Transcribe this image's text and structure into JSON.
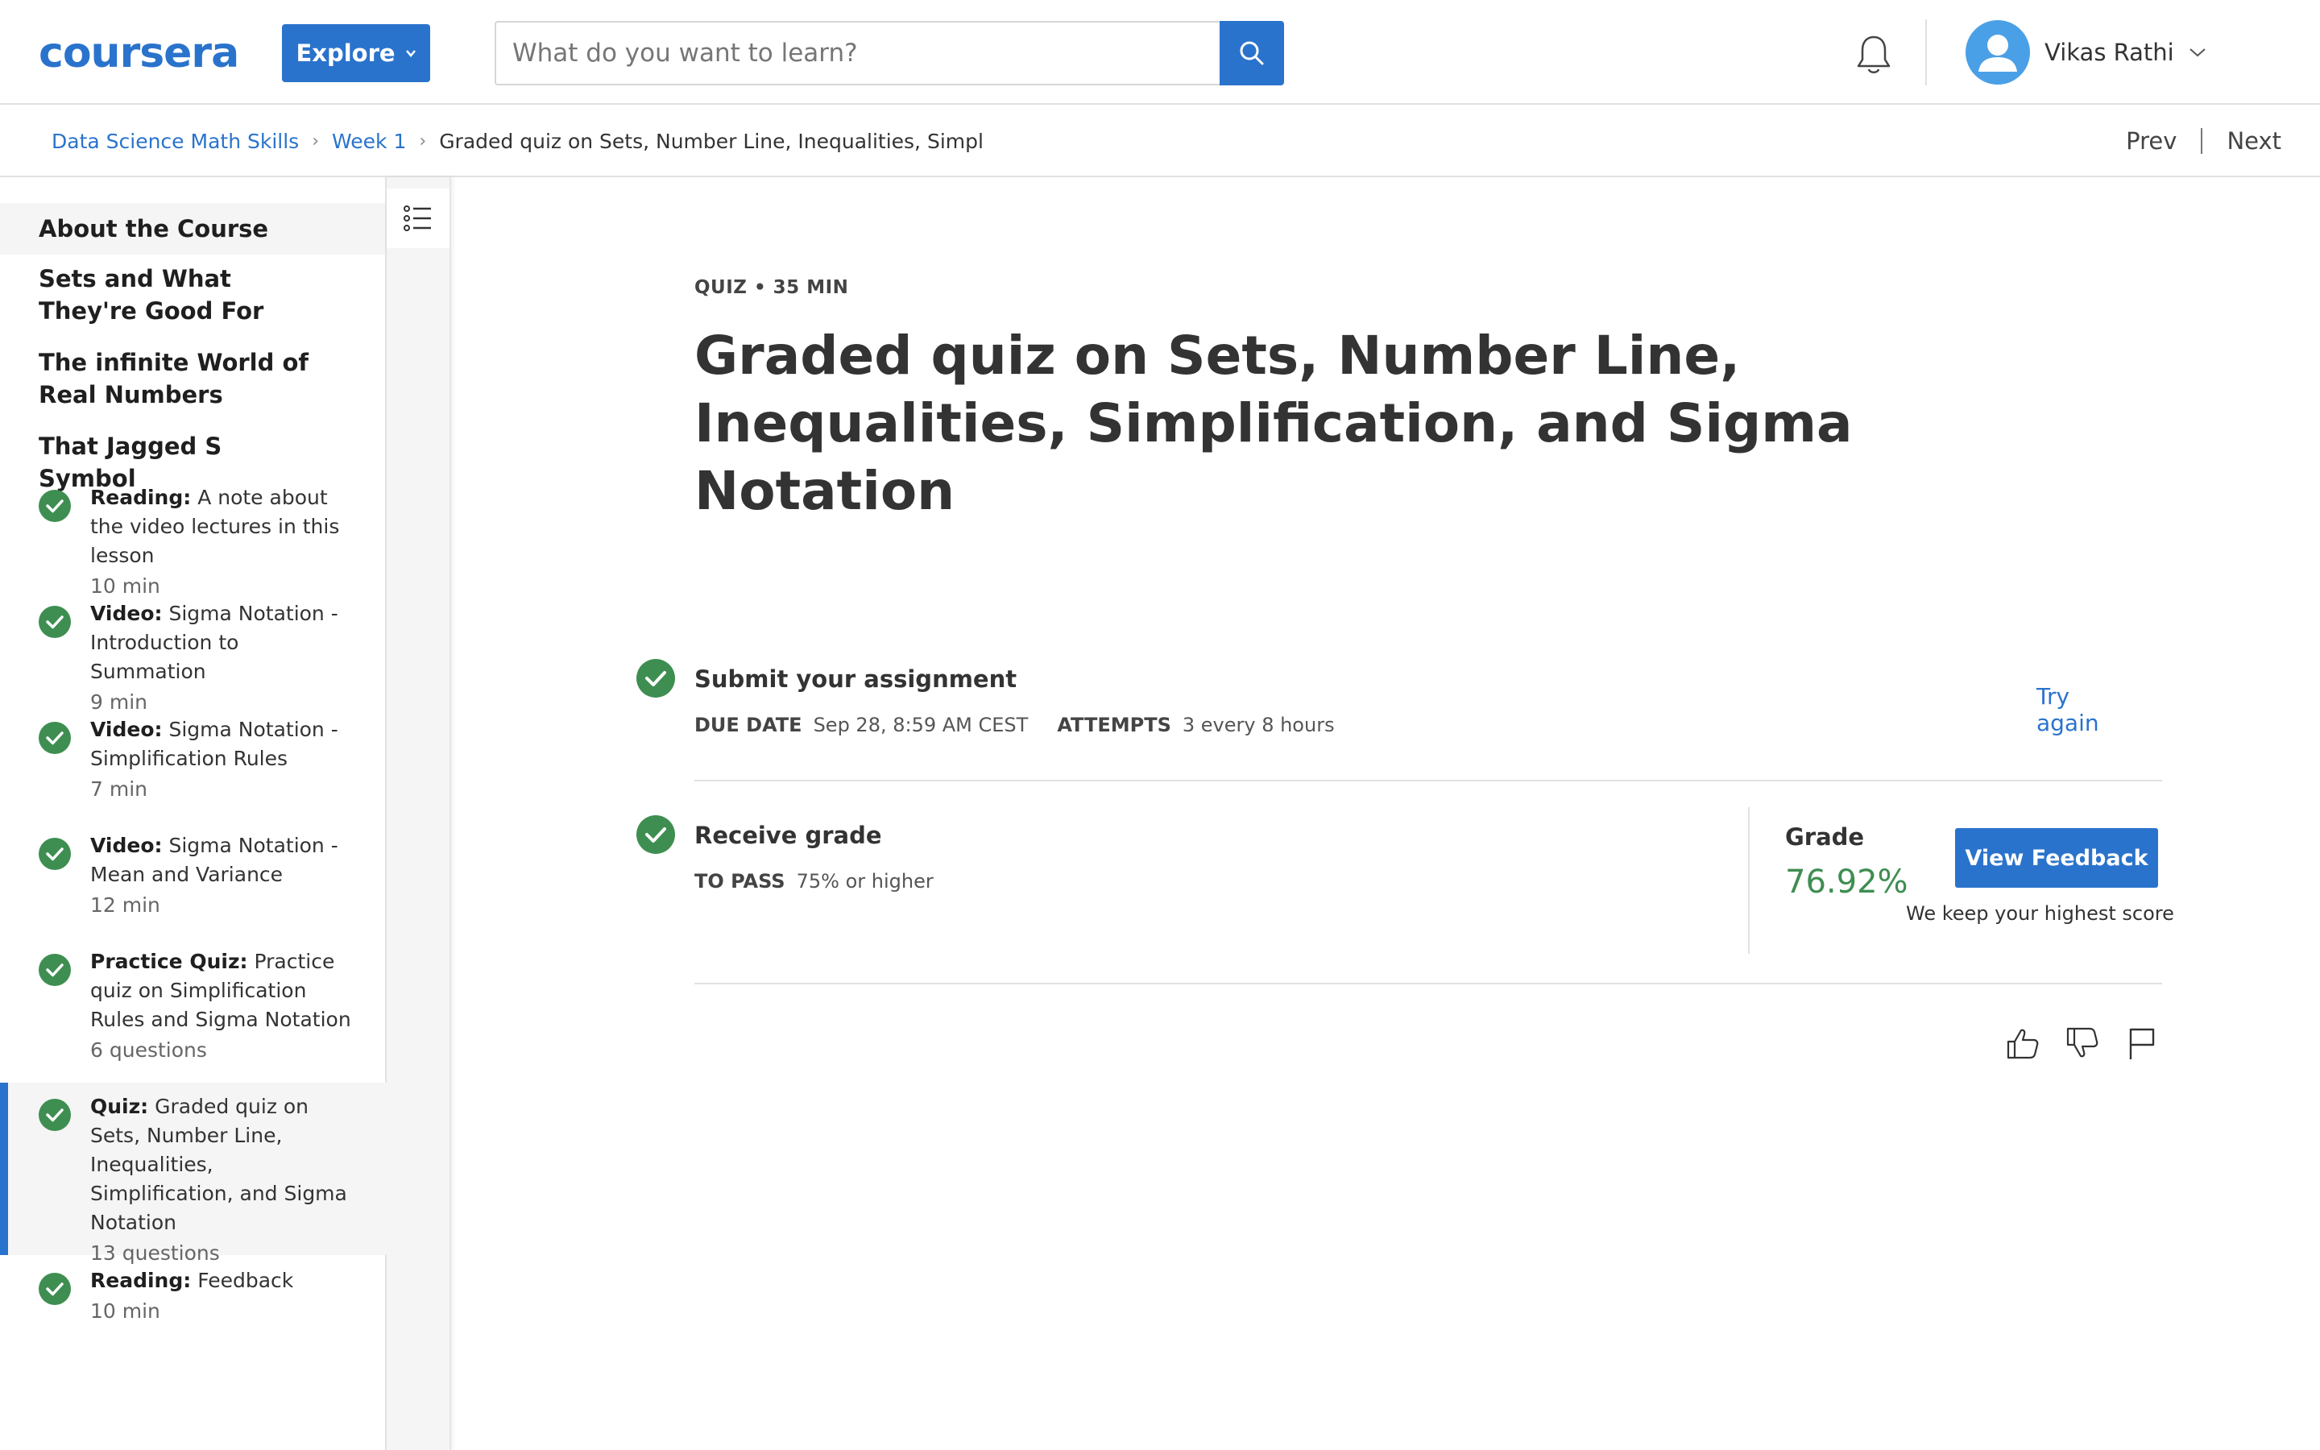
{
  "header": {
    "logo_text": "coursera",
    "explore_label": "Explore",
    "search_placeholder": "What do you want to learn?",
    "user_name": "Vikas Rathi"
  },
  "breadcrumb": {
    "items": [
      "Data Science Math Skills",
      "Week 1"
    ],
    "current": "Graded quiz on Sets, Number Line, Inequalities, Simpl"
  },
  "nav": {
    "prev": "Prev",
    "next": "Next"
  },
  "sidebar": {
    "sections": [
      "About the Course",
      "Sets and What They're Good For",
      "The infinite World of Real Numbers",
      "That Jagged S Symbol"
    ],
    "items": [
      {
        "type": "Reading:",
        "title": "A note about the video lectures in this lesson",
        "meta": "10 min"
      },
      {
        "type": "Video:",
        "title": "Sigma Notation - Introduction to Summation",
        "meta": "9 min"
      },
      {
        "type": "Video:",
        "title": "Sigma Notation - Simplification Rules",
        "meta": "7 min"
      },
      {
        "type": "Video:",
        "title": "Sigma Notation - Mean and Variance",
        "meta": "12 min"
      },
      {
        "type": "Practice Quiz:",
        "title": "Practice quiz on Simplification Rules and Sigma Notation",
        "meta": "6 questions"
      },
      {
        "type": "Quiz:",
        "title": "Graded quiz on Sets, Number Line, Inequalities, Simplification, and Sigma Notation",
        "meta": "13 questions"
      },
      {
        "type": "Reading:",
        "title": "Feedback",
        "meta": "10 min"
      }
    ]
  },
  "main": {
    "kicker": "QUIZ • 35 MIN",
    "title": "Graded quiz on Sets, Number Line, Inequalities, Simplification, and Sigma Notation",
    "submit": {
      "title": "Submit your assignment",
      "due_label": "DUE DATE",
      "due_value": "Sep 28, 8:59 AM CEST",
      "attempts_label": "ATTEMPTS",
      "attempts_value": "3 every 8 hours",
      "try_again": "Try again"
    },
    "receive": {
      "title": "Receive grade",
      "pass_label": "TO PASS",
      "pass_value": "75% or higher",
      "grade_label": "Grade",
      "grade_value": "76.92%",
      "feedback_button": "View Feedback",
      "keep_note": "We keep your highest score"
    }
  },
  "colors": {
    "brand_blue": "#2a73cc",
    "success_green": "#3e8e51",
    "divider": "#e1e1e1"
  }
}
